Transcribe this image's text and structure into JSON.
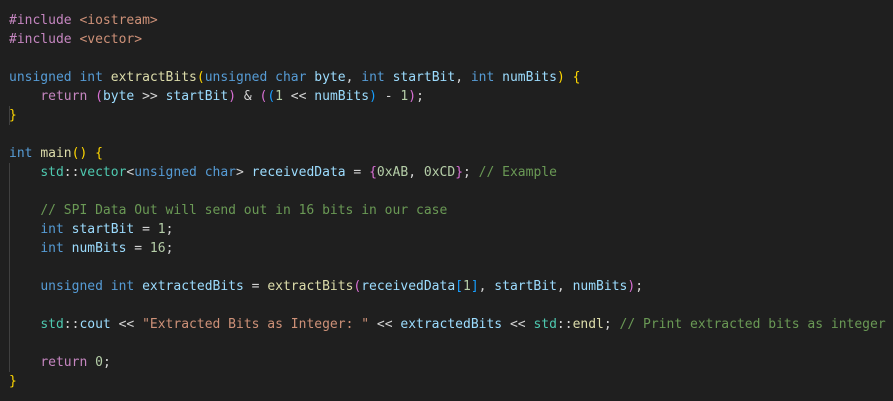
{
  "editor": {
    "theme": "dark",
    "background": "#1f1f1f",
    "language": "cpp"
  },
  "colors": {
    "keyword": "#569cd6",
    "control": "#c586c0",
    "function": "#dcdcaa",
    "variable": "#9cdcfe",
    "number": "#b5cea8",
    "string": "#ce9178",
    "comment": "#6a9955",
    "type": "#4ec9b0",
    "bracket1": "#ffd700",
    "bracket2": "#da70d6",
    "bracket3": "#179fff"
  },
  "code": {
    "l1": [
      {
        "c": "c",
        "t": "#include"
      },
      {
        "c": "p",
        "t": " "
      },
      {
        "c": "s",
        "t": "<iostream>"
      }
    ],
    "l2": [
      {
        "c": "c",
        "t": "#include"
      },
      {
        "c": "p",
        "t": " "
      },
      {
        "c": "s",
        "t": "<vector>"
      }
    ],
    "l3": [],
    "l4": [
      {
        "c": "k",
        "t": "unsigned"
      },
      {
        "c": "p",
        "t": " "
      },
      {
        "c": "k",
        "t": "int"
      },
      {
        "c": "p",
        "t": " "
      },
      {
        "c": "f",
        "t": "extractBits"
      },
      {
        "c": "b1",
        "t": "("
      },
      {
        "c": "k",
        "t": "unsigned"
      },
      {
        "c": "p",
        "t": " "
      },
      {
        "c": "k",
        "t": "char"
      },
      {
        "c": "p",
        "t": " "
      },
      {
        "c": "v",
        "t": "byte"
      },
      {
        "c": "p",
        "t": ", "
      },
      {
        "c": "k",
        "t": "int"
      },
      {
        "c": "p",
        "t": " "
      },
      {
        "c": "v",
        "t": "startBit"
      },
      {
        "c": "p",
        "t": ", "
      },
      {
        "c": "k",
        "t": "int"
      },
      {
        "c": "p",
        "t": " "
      },
      {
        "c": "v",
        "t": "numBits"
      },
      {
        "c": "b1",
        "t": ")"
      },
      {
        "c": "p",
        "t": " "
      },
      {
        "c": "b1",
        "t": "{"
      }
    ],
    "l5": [
      {
        "c": "p",
        "t": "    "
      },
      {
        "c": "c",
        "t": "return"
      },
      {
        "c": "p",
        "t": " "
      },
      {
        "c": "b2",
        "t": "("
      },
      {
        "c": "v",
        "t": "byte"
      },
      {
        "c": "p",
        "t": " >> "
      },
      {
        "c": "v",
        "t": "startBit"
      },
      {
        "c": "b2",
        "t": ")"
      },
      {
        "c": "p",
        "t": " & "
      },
      {
        "c": "b2",
        "t": "("
      },
      {
        "c": "b3",
        "t": "("
      },
      {
        "c": "n",
        "t": "1"
      },
      {
        "c": "p",
        "t": " << "
      },
      {
        "c": "v",
        "t": "numBits"
      },
      {
        "c": "b3",
        "t": ")"
      },
      {
        "c": "p",
        "t": " - "
      },
      {
        "c": "n",
        "t": "1"
      },
      {
        "c": "b2",
        "t": ")"
      },
      {
        "c": "p",
        "t": ";"
      }
    ],
    "l6": [
      {
        "c": "b1",
        "t": "}"
      }
    ],
    "l7": [],
    "l8": [
      {
        "c": "k",
        "t": "int"
      },
      {
        "c": "p",
        "t": " "
      },
      {
        "c": "f",
        "t": "main"
      },
      {
        "c": "b1",
        "t": "()"
      },
      {
        "c": "p",
        "t": " "
      },
      {
        "c": "b1",
        "t": "{"
      }
    ],
    "l9": [
      {
        "c": "p",
        "t": "    "
      },
      {
        "c": "t",
        "t": "std"
      },
      {
        "c": "p",
        "t": "::"
      },
      {
        "c": "t",
        "t": "vector"
      },
      {
        "c": "p",
        "t": "<"
      },
      {
        "c": "k",
        "t": "unsigned"
      },
      {
        "c": "p",
        "t": " "
      },
      {
        "c": "k",
        "t": "char"
      },
      {
        "c": "p",
        "t": "> "
      },
      {
        "c": "v",
        "t": "receivedData"
      },
      {
        "c": "p",
        "t": " = "
      },
      {
        "c": "b2",
        "t": "{"
      },
      {
        "c": "n",
        "t": "0xAB"
      },
      {
        "c": "p",
        "t": ", "
      },
      {
        "c": "n",
        "t": "0xCD"
      },
      {
        "c": "b2",
        "t": "}"
      },
      {
        "c": "p",
        "t": "; "
      },
      {
        "c": "cm",
        "t": "// Example"
      }
    ],
    "l10": [],
    "l11": [
      {
        "c": "p",
        "t": "    "
      },
      {
        "c": "cm",
        "t": "// SPI Data Out will send out in 16 bits in our case"
      }
    ],
    "l12": [
      {
        "c": "p",
        "t": "    "
      },
      {
        "c": "k",
        "t": "int"
      },
      {
        "c": "p",
        "t": " "
      },
      {
        "c": "v",
        "t": "startBit"
      },
      {
        "c": "p",
        "t": " = "
      },
      {
        "c": "n",
        "t": "1"
      },
      {
        "c": "p",
        "t": ";"
      }
    ],
    "l13": [
      {
        "c": "p",
        "t": "    "
      },
      {
        "c": "k",
        "t": "int"
      },
      {
        "c": "p",
        "t": " "
      },
      {
        "c": "v",
        "t": "numBits"
      },
      {
        "c": "p",
        "t": " = "
      },
      {
        "c": "n",
        "t": "16"
      },
      {
        "c": "p",
        "t": ";"
      }
    ],
    "l14": [],
    "l15": [
      {
        "c": "p",
        "t": "    "
      },
      {
        "c": "k",
        "t": "unsigned"
      },
      {
        "c": "p",
        "t": " "
      },
      {
        "c": "k",
        "t": "int"
      },
      {
        "c": "p",
        "t": " "
      },
      {
        "c": "v",
        "t": "extractedBits"
      },
      {
        "c": "p",
        "t": " = "
      },
      {
        "c": "f",
        "t": "extractBits"
      },
      {
        "c": "b2",
        "t": "("
      },
      {
        "c": "v",
        "t": "receivedData"
      },
      {
        "c": "b3",
        "t": "["
      },
      {
        "c": "n",
        "t": "1"
      },
      {
        "c": "b3",
        "t": "]"
      },
      {
        "c": "p",
        "t": ", "
      },
      {
        "c": "v",
        "t": "startBit"
      },
      {
        "c": "p",
        "t": ", "
      },
      {
        "c": "v",
        "t": "numBits"
      },
      {
        "c": "b2",
        "t": ")"
      },
      {
        "c": "p",
        "t": ";"
      }
    ],
    "l16": [],
    "l17": [
      {
        "c": "p",
        "t": "    "
      },
      {
        "c": "t",
        "t": "std"
      },
      {
        "c": "p",
        "t": "::"
      },
      {
        "c": "v",
        "t": "cout"
      },
      {
        "c": "p",
        "t": " << "
      },
      {
        "c": "s",
        "t": "\"Extracted Bits as Integer: \""
      },
      {
        "c": "p",
        "t": " << "
      },
      {
        "c": "v",
        "t": "extractedBits"
      },
      {
        "c": "p",
        "t": " << "
      },
      {
        "c": "t",
        "t": "std"
      },
      {
        "c": "p",
        "t": "::"
      },
      {
        "c": "f",
        "t": "endl"
      },
      {
        "c": "p",
        "t": "; "
      },
      {
        "c": "cm",
        "t": "// Print extracted bits as integer"
      }
    ],
    "l18": [],
    "l19": [
      {
        "c": "p",
        "t": "    "
      },
      {
        "c": "c",
        "t": "return"
      },
      {
        "c": "p",
        "t": " "
      },
      {
        "c": "n",
        "t": "0"
      },
      {
        "c": "p",
        "t": ";"
      }
    ],
    "l20": [
      {
        "c": "b1",
        "t": "}"
      }
    ]
  }
}
